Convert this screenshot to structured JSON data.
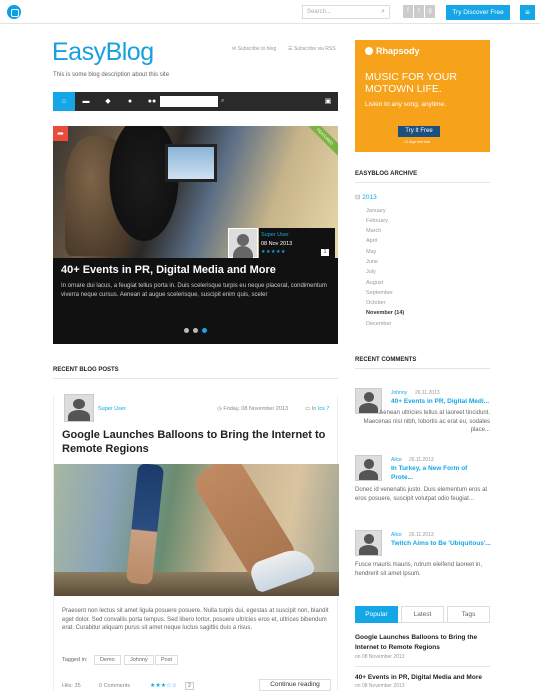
{
  "topbar": {
    "search_placeholder": "Search...",
    "social_icons": [
      "facebook-icon",
      "twitter-icon",
      "google-plus-icon"
    ],
    "cta_label": "Try Discover Free",
    "menu_icon": "hamburger-icon"
  },
  "site": {
    "title": "EasyBlog",
    "description": "This is some blog description about this site",
    "subscribe_blog": "Subscribe to blog",
    "subscribe_rss": "Subscribe via RSS"
  },
  "nav": {
    "icons": [
      "home-icon",
      "folder-icon",
      "tag-icon",
      "user-icon",
      "users-icon",
      "search-icon",
      "lock-icon"
    ],
    "search_value": ""
  },
  "hero": {
    "badge": "FEATURED",
    "author": "Super User",
    "date": "08 Nov 2013",
    "stars": "★★★★★",
    "rating_count": "1",
    "title": "40+ Events in PR, Digital Media and More",
    "excerpt": "In ornare dui lacus, a feugiat tellus porta in. Duis scelerisque turpis eu neque placerat, condimentum viverra neque cursus. Aenean at augue scelerisque, suscipit enim quis, sceler",
    "slides": 3,
    "active_slide": 3
  },
  "recent_posts": {
    "heading": "RECENT BLOG POSTS",
    "post": {
      "author": "Super User",
      "date": "Friday, 08 November 2013",
      "category_prefix": "In",
      "category": "Ics 7",
      "title": "Google Launches Balloons to Bring the Internet to Remote Regions",
      "excerpt": "Praesent non lectus sit amet ligula posuere posuere. Nulla turpis dui, egestas at suscipit non, blandit eget dolor. Sed convallis porta tempus. Sed libero tortor, posuere ultricies eros et, ultrices bibendum erat. Curabitur aliquam purus sit amet neque luctus sagittis duis a risus.",
      "tags_label": "Tagged in:",
      "tags": [
        "Demo",
        "Johnny",
        "Post"
      ],
      "hits": "Hits: 35",
      "comments": "0 Comments",
      "stars": "★★★☆☆",
      "rating_count": "2",
      "continue_label": "Continue reading"
    }
  },
  "ad": {
    "brand": "Rhapsody",
    "headline": "MUSIC FOR YOUR MOTOWN LIFE.",
    "subline": "Listen to any song, anytime.",
    "button": "Try It Free",
    "fine": "14 days free trial"
  },
  "archive": {
    "heading": "EASYBLOG ARCHIVE",
    "year": "2013",
    "months": [
      "January",
      "February",
      "March",
      "April",
      "May",
      "June",
      "July",
      "August",
      "September",
      "October",
      "November (14)",
      "December"
    ]
  },
  "comments": {
    "heading": "RECENT COMMENTS",
    "items": [
      {
        "author": "Johnny",
        "date": "26.11.2013",
        "title": "40+ Events in PR, Digital Medi...",
        "text": "Aenean ultricies tellus at laoreet tincidunt. Maecenas nisl nibh, lobortis ac erat eu, sodales place..."
      },
      {
        "author": "Alice",
        "date": "26.11.2013",
        "title": "In Turkey, a New Form of Prote...",
        "text": "Donec id venenatis justo. Duis elementum eros at eros posuere, suscipit volutpat odio feugiat..."
      },
      {
        "author": "Alice",
        "date": "26.11.2013",
        "title": "Twitch Aims to Be 'Ubiquitous'...",
        "text": "Fusce mauris mauris, rutrum eleifend laoreet in, hendrerit sit amet ipsum."
      }
    ]
  },
  "tabs": {
    "items": [
      "Popular",
      "Latest",
      "Tags"
    ],
    "active": "Popular",
    "posts": [
      {
        "title": "Google Launches Balloons to Bring the Internet to Remote Regions",
        "date": "on 08 November 2013"
      },
      {
        "title": "40+ Events in PR, Digital Media and More",
        "date": "on 08 November 2013"
      }
    ]
  },
  "colors": {
    "accent": "#14a6e6",
    "ad_orange": "#f7a21b",
    "navbar": "#2a2a2a",
    "share": "#e84c3d"
  }
}
